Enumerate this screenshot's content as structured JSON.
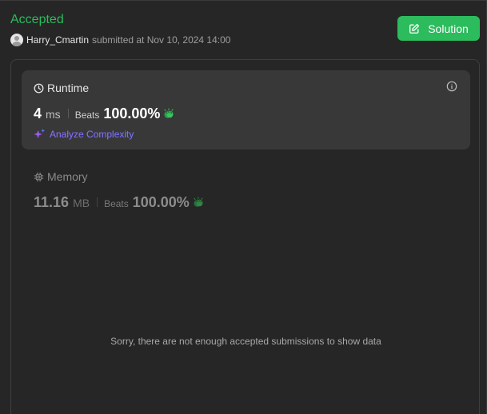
{
  "header": {
    "status": "Accepted",
    "username": "Harry_Cmartin",
    "submitted_text": "submitted at Nov 10, 2024 14:00",
    "solution_label": "Solution"
  },
  "runtime": {
    "title": "Runtime",
    "value": "4",
    "unit": "ms",
    "beats_label": "Beats",
    "beats_value": "100.00%",
    "analyze_label": "Analyze Complexity"
  },
  "memory": {
    "title": "Memory",
    "value": "11.16",
    "unit": "MB",
    "beats_label": "Beats",
    "beats_value": "100.00%"
  },
  "empty_message": "Sorry, there are not enough accepted submissions to show data",
  "colors": {
    "accent_green": "#2cbb5d",
    "background": "#262626",
    "card": "#383838"
  },
  "icons": {
    "solution": "edit-icon",
    "runtime": "clock-icon",
    "memory": "chip-icon",
    "info": "info-icon",
    "clap": "clapping-hands-icon",
    "analyze": "sparkle-icon"
  }
}
